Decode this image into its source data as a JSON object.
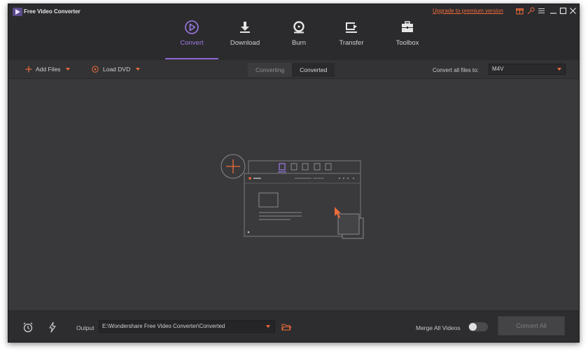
{
  "app": {
    "title": "Free Video Converter",
    "upgrade_link": "Upgrade to premium version"
  },
  "nav": {
    "tabs": [
      {
        "label": "Convert",
        "icon": "convert-icon",
        "active": true
      },
      {
        "label": "Download",
        "icon": "download-icon",
        "active": false
      },
      {
        "label": "Burn",
        "icon": "burn-icon",
        "active": false
      },
      {
        "label": "Transfer",
        "icon": "transfer-icon",
        "active": false
      },
      {
        "label": "Toolbox",
        "icon": "toolbox-icon",
        "active": false
      }
    ]
  },
  "toolbar": {
    "add_files": "Add Files",
    "load_dvd": "Load DVD",
    "segment": {
      "converting": "Converting",
      "converted": "Converted",
      "selected": "Converted"
    },
    "convert_all_label": "Convert all files to:",
    "format_value": "M4V"
  },
  "bottom": {
    "output_label": "Output",
    "output_path": "E:\\Wondershare Free Video Converter\\Converted",
    "merge_label": "Merge All Videos",
    "merge_enabled": false,
    "convert_all_button": "Convert All"
  },
  "colors": {
    "accent": "#8f6ad8",
    "orange": "#ee6b3b",
    "background": "#39393b",
    "titlebar": "#2b2b2d"
  }
}
